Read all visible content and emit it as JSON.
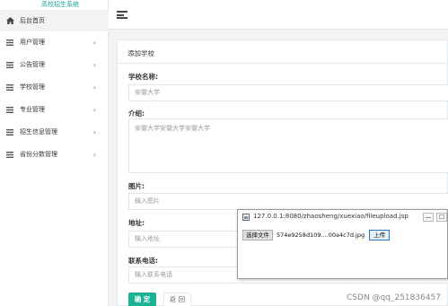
{
  "sidebar": {
    "brand": "高校招生系统",
    "items": [
      {
        "label": "后台首页",
        "icon": "home-icon",
        "has_chevron": false
      },
      {
        "label": "用户管理",
        "icon": "list-icon",
        "has_chevron": true
      },
      {
        "label": "公告管理",
        "icon": "list-icon",
        "has_chevron": true
      },
      {
        "label": "学校管理",
        "icon": "list-icon",
        "has_chevron": true
      },
      {
        "label": "专业管理",
        "icon": "list-icon",
        "has_chevron": true
      },
      {
        "label": "招生信息管理",
        "icon": "list-icon",
        "has_chevron": true
      },
      {
        "label": "省份分数管理",
        "icon": "list-icon",
        "has_chevron": true
      }
    ],
    "chevron": "›"
  },
  "form": {
    "title": "添加学校",
    "school_name_label": "学校名称:",
    "school_name_value": "安徽大学",
    "intro_label": "介绍:",
    "intro_value": "安徽大学安徽大学安徽大学",
    "image_label": "图片:",
    "image_placeholder": "输入图片",
    "address_label": "地址:",
    "address_placeholder": "输入地址",
    "phone_label": "联系电话:",
    "phone_placeholder": "输入联系电话",
    "submit_label": "确 定",
    "back_label": "返 回"
  },
  "popup": {
    "title": "127.0.0.1:8080/zhaosheng/xuexiao/fileupload.jsp",
    "minimize": "—",
    "maximize": "☐",
    "choose_label": "选择文件",
    "file_name": "574e9258d109....00a4c7d.jpg",
    "upload_label": "上传"
  },
  "watermark": "CSDN @qq_251836457",
  "colors": {
    "accent": "#1ab394",
    "brand_text": "#1aa094",
    "background": "#f3f3f4"
  }
}
